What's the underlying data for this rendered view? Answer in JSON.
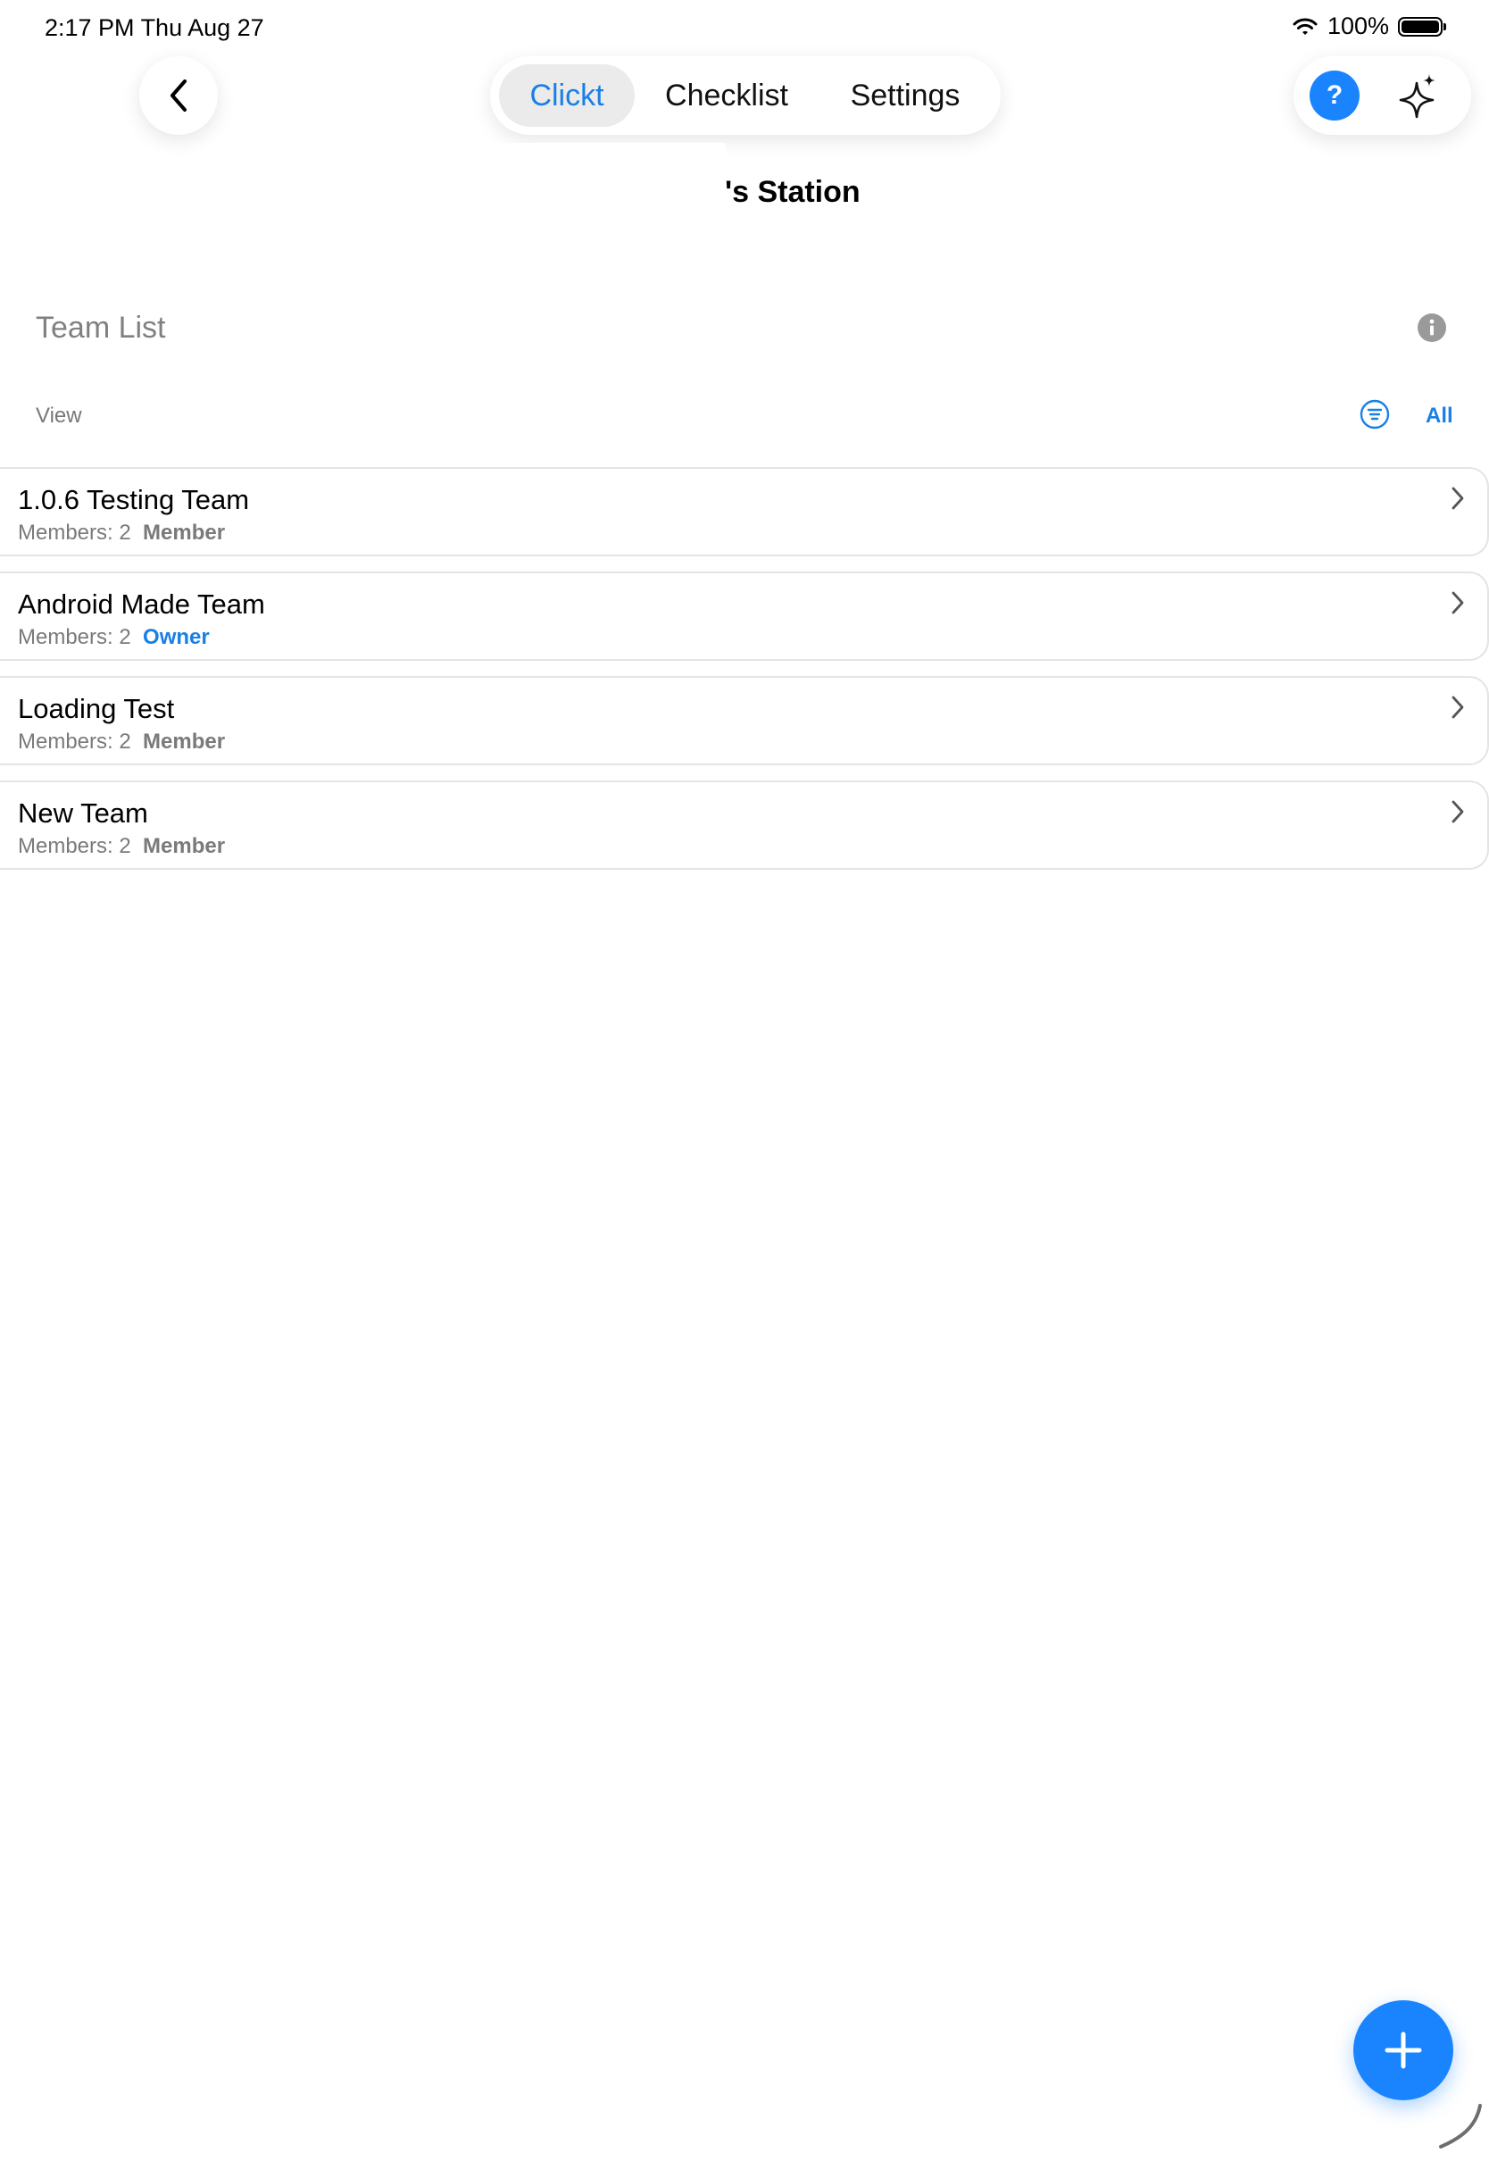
{
  "status_bar": {
    "time": "2:17 PM   Thu Aug 27",
    "battery": "100%",
    "battery_level": 1.0
  },
  "nav": {
    "back_icon": "chevron-left-icon",
    "tabs": [
      {
        "label": "Clickt",
        "active": true
      },
      {
        "label": "Checklist",
        "active": false
      },
      {
        "label": "Settings",
        "active": false
      }
    ],
    "help_label": "?",
    "sparkle_icon": "sparkle-icon"
  },
  "station": {
    "title": "'s Station"
  },
  "team_list": {
    "title": "Team List",
    "view_label": "View",
    "filter_value": "All",
    "teams": [
      {
        "name": "1.0.6 Testing Team",
        "members": "Members: 2",
        "role": "Member"
      },
      {
        "name": "Android Made Team",
        "members": "Members: 2",
        "role": "Owner"
      },
      {
        "name": "Loading Test",
        "members": "Members: 2",
        "role": "Member"
      },
      {
        "name": "New Team",
        "members": "Members: 2",
        "role": "Member"
      }
    ]
  },
  "colors": {
    "accent": "#1a84ff",
    "accent_text": "#1a7fe6",
    "muted_text": "#7a7a7a",
    "card_border": "#e4e4e4"
  }
}
